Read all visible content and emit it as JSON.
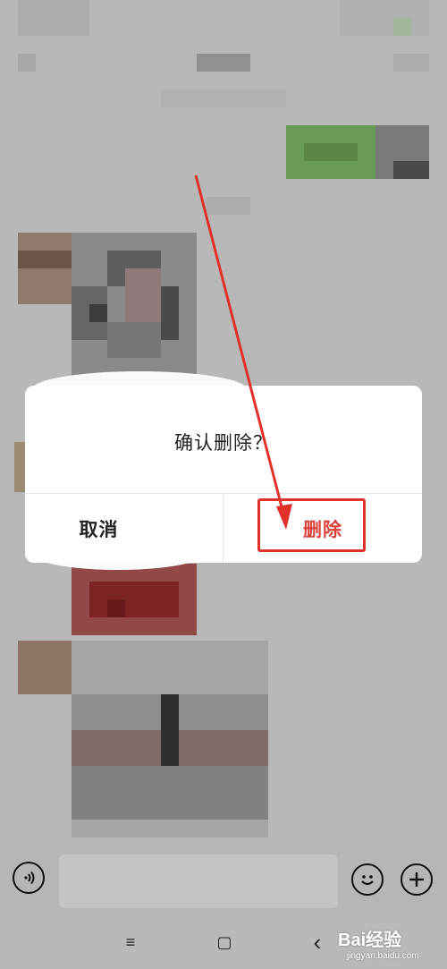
{
  "dialog": {
    "message": "确认删除？",
    "cancel_label": "取消",
    "delete_label": "删除"
  },
  "input": {
    "placeholder": ""
  },
  "watermark": {
    "brand": "Bai经验",
    "url": "jingyan.baidu.com"
  },
  "nav": {
    "menu_glyph": "≡",
    "home_glyph": "▢",
    "back_glyph": "‹"
  },
  "colors": {
    "accent_red": "#d9413a",
    "annotation_red": "#e2312b"
  }
}
